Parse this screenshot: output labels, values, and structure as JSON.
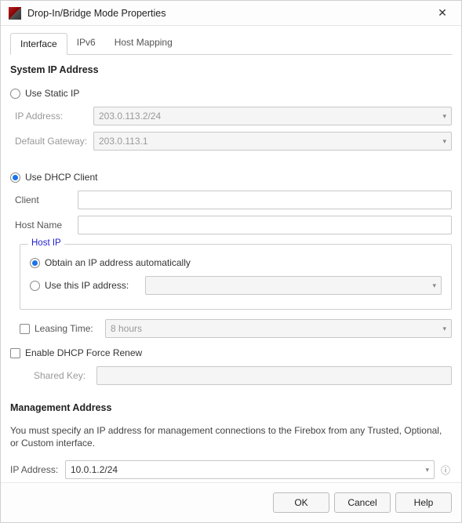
{
  "window": {
    "title": "Drop-In/Bridge Mode Properties"
  },
  "tabs": {
    "interface": "Interface",
    "ipv6": "IPv6",
    "host_mapping": "Host Mapping",
    "active": "interface"
  },
  "system_ip": {
    "heading": "System IP Address",
    "static_label": "Use Static IP",
    "ip_address_label": "IP Address:",
    "ip_address_value": "203.0.113.2/24",
    "gateway_label": "Default Gateway:",
    "gateway_value": "203.0.113.1",
    "dhcp_label": "Use DHCP Client",
    "mode": "dhcp",
    "client_label": "Client",
    "client_value": "",
    "hostname_label": "Host Name",
    "hostname_value": "",
    "host_ip": {
      "group_title": "Host IP",
      "auto_label": "Obtain an IP address automatically",
      "manual_label": "Use this IP address:",
      "manual_value": "",
      "mode": "auto"
    },
    "leasing_time": {
      "enabled": false,
      "label": "Leasing Time:",
      "value": "8 hours"
    },
    "force_renew": {
      "enabled": false,
      "label": "Enable DHCP Force Renew",
      "shared_key_label": "Shared Key:",
      "shared_key_value": ""
    }
  },
  "management": {
    "heading": "Management Address",
    "description": "You must specify an IP address for management connections to the Firebox from any Trusted, Optional, or Custom interface.",
    "ip_label": "IP Address:",
    "ip_value": "10.0.1.2/24"
  },
  "buttons": {
    "ok": "OK",
    "cancel": "Cancel",
    "help": "Help"
  }
}
